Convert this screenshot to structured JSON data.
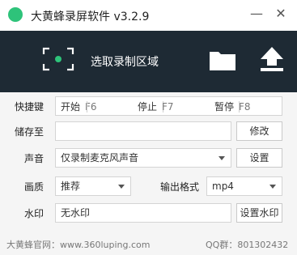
{
  "window": {
    "title": "大黄蜂录屏软件 v3.2.9",
    "minimize_glyph": "—",
    "close_glyph": "✕"
  },
  "toolbar": {
    "select_area_label": "选取录制区域",
    "icons": [
      "select-area-icon",
      "folder-icon",
      "export-icon"
    ]
  },
  "hotkeys": {
    "label": "快捷键",
    "start": {
      "label": "开始",
      "key": "F6"
    },
    "stop": {
      "label": "停止",
      "key": "F7"
    },
    "pause": {
      "label": "暂停",
      "key": "F8"
    }
  },
  "save": {
    "label": "储存至",
    "path_value": "",
    "change_button": "修改"
  },
  "audio": {
    "label": "声音",
    "selected": "仅录制麦克风声音",
    "settings_button": "设置"
  },
  "quality": {
    "label": "画质",
    "selected": "推荐"
  },
  "format": {
    "label": "输出格式",
    "selected": "mp4"
  },
  "watermark": {
    "label": "水印",
    "value": "无水印",
    "settings_button": "设置水印"
  },
  "footer": {
    "website": "大黄蜂官网：www.360luping.com",
    "qq": "QQ群：801302432"
  },
  "colors": {
    "toolbar_bg": "#1e2a34",
    "accent_green": "#2ec37a"
  }
}
